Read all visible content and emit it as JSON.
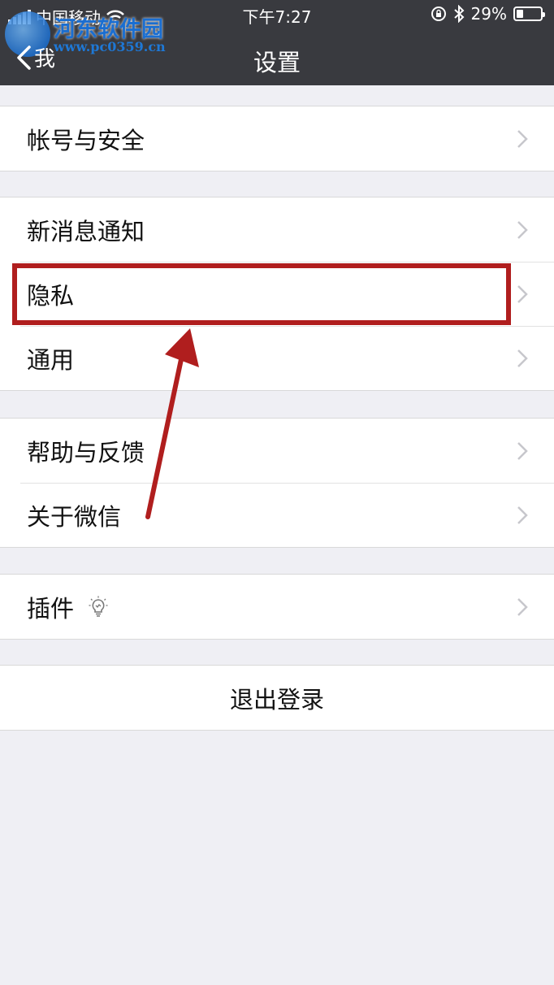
{
  "status_bar": {
    "carrier": "中国移动",
    "time": "下午7:27",
    "battery_percent": "29%",
    "battery_level": 0.29,
    "icons": [
      "signal-icon",
      "wifi-icon",
      "rotation-lock-icon",
      "bluetooth-icon",
      "battery-icon"
    ]
  },
  "watermark": {
    "name": "河东软件园",
    "url": "www.pc0359.cn"
  },
  "nav": {
    "back_label": "我",
    "title": "设置"
  },
  "groups": [
    {
      "items": [
        {
          "label": "帐号与安全"
        }
      ]
    },
    {
      "items": [
        {
          "label": "新消息通知"
        },
        {
          "label": "隐私"
        },
        {
          "label": "通用"
        }
      ]
    },
    {
      "items": [
        {
          "label": "帮助与反馈"
        },
        {
          "label": "关于微信"
        }
      ]
    },
    {
      "items": [
        {
          "label": "插件",
          "icon": "lightbulb-icon"
        }
      ]
    }
  ],
  "logout_label": "退出登录",
  "annotation": {
    "highlight_color": "#b01e1e",
    "arrow_color": "#b01e1e",
    "highlighted_item": "隐私"
  },
  "colors": {
    "nav_bg": "#393a3f",
    "page_bg": "#efeff4",
    "chevron": "#c7c7cc"
  }
}
